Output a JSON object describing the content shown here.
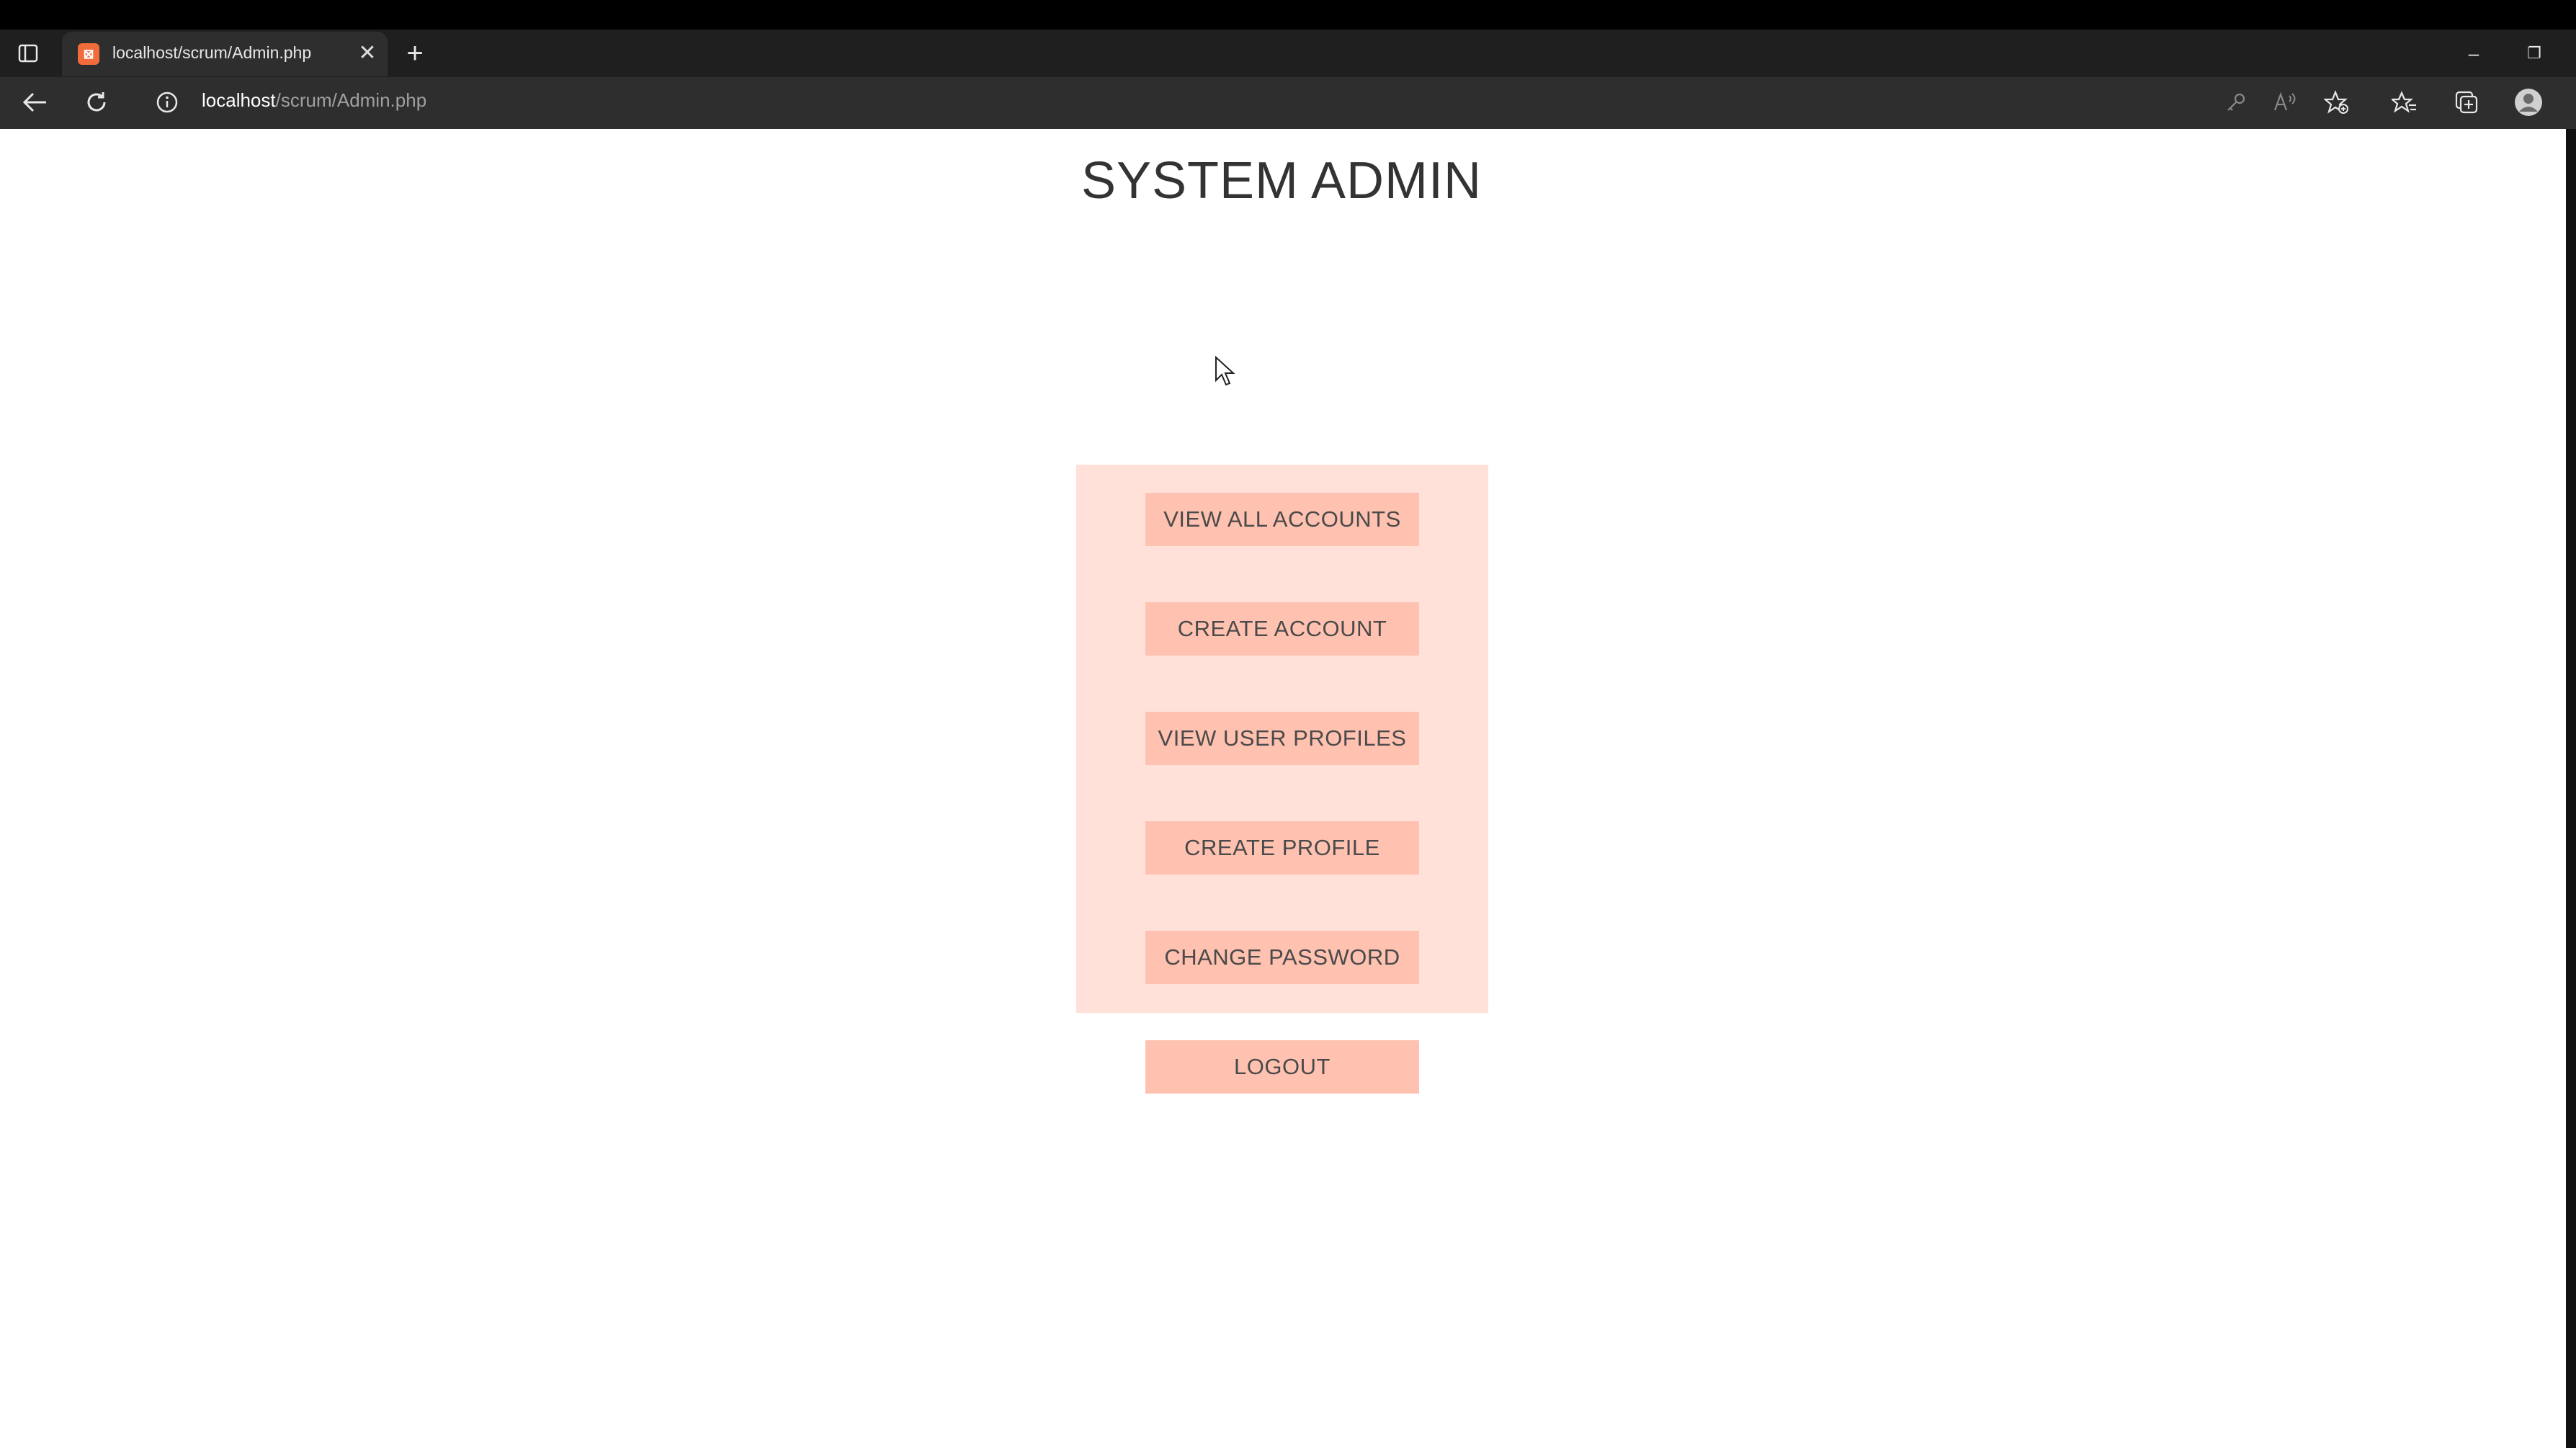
{
  "browser": {
    "tab": {
      "title": "localhost/scrum/Admin.php",
      "close_glyph": "✕",
      "favicon_glyph": "⊠"
    },
    "new_tab_glyph": "+",
    "window_controls": {
      "minimize_glyph": "–",
      "restore_glyph": "❐"
    },
    "address": {
      "host": "localhost",
      "path": "/scrum/Admin.php"
    }
  },
  "page": {
    "title": "SYSTEM ADMIN",
    "menu": {
      "view_all_accounts": "VIEW ALL ACCOUNTS",
      "create_account": "CREATE ACCOUNT",
      "view_user_profiles": "VIEW USER PROFILES",
      "create_profile": "CREATE PROFILE",
      "change_password": "CHANGE PASSWORD"
    },
    "logout": "LOGOUT"
  },
  "colors": {
    "panel_bg": "#ffe1da",
    "button_bg": "#ffc1b0",
    "title_text": "#333333",
    "browser_chrome": "#2e2e2e"
  }
}
